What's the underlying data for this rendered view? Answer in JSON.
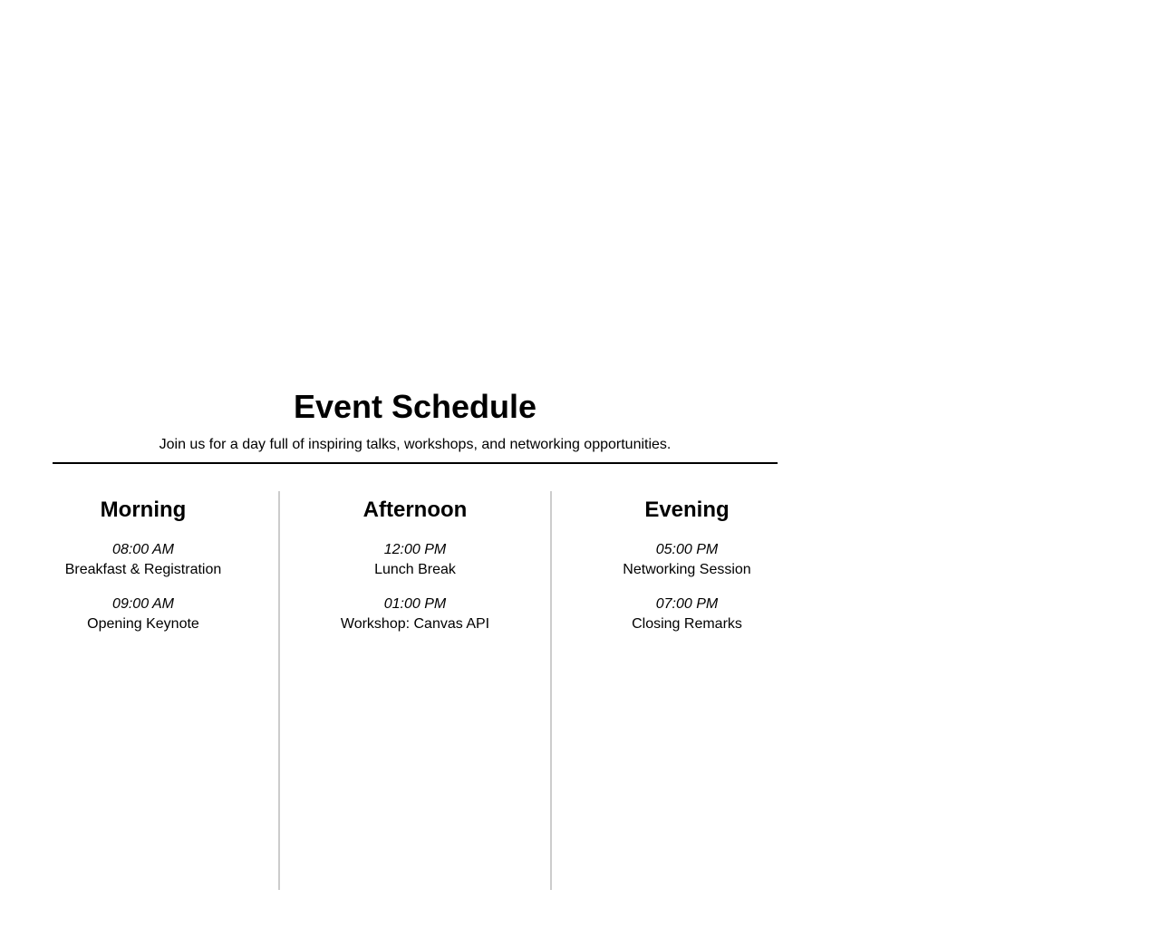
{
  "header": {
    "title": "Event Schedule",
    "subtitle": "Join us for a day full of inspiring talks, workshops, and networking opportunities."
  },
  "colors": {
    "text": "#000000",
    "divider": "#000000",
    "column_border": "#cccccc",
    "background": "#ffffff"
  },
  "columns": [
    {
      "label": "Morning",
      "items": [
        {
          "time": "08:00 AM",
          "title": "Breakfast & Registration"
        },
        {
          "time": "09:00 AM",
          "title": "Opening Keynote"
        }
      ]
    },
    {
      "label": "Afternoon",
      "items": [
        {
          "time": "12:00 PM",
          "title": "Lunch Break"
        },
        {
          "time": "01:00 PM",
          "title": "Workshop: Canvas API"
        }
      ]
    },
    {
      "label": "Evening",
      "items": [
        {
          "time": "05:00 PM",
          "title": "Networking Session"
        },
        {
          "time": "07:00 PM",
          "title": "Closing Remarks"
        }
      ]
    }
  ]
}
